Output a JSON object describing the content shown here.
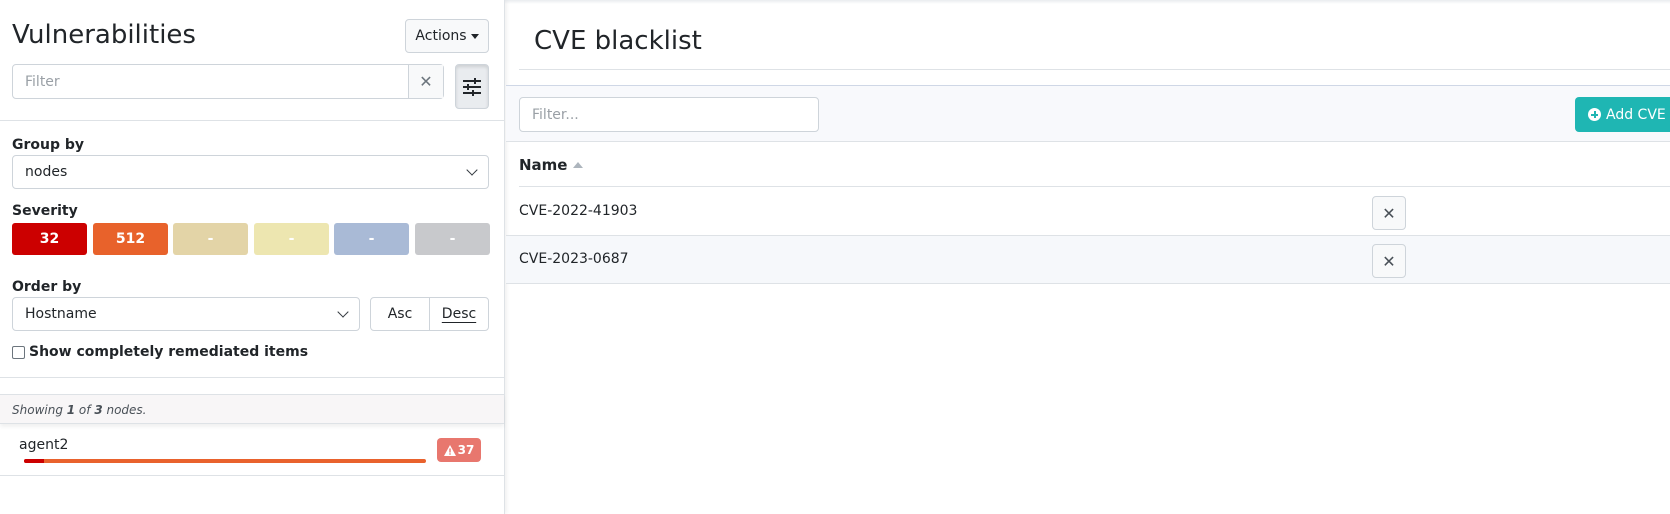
{
  "left": {
    "title": "Vulnerabilities",
    "actions_label": "Actions",
    "filter_placeholder": "Filter",
    "clear_glyph": "✕",
    "group_by_label": "Group by",
    "group_by_value": "nodes",
    "severity_label": "Severity",
    "severity": [
      {
        "label": "32",
        "color": "#cc0000"
      },
      {
        "label": "512",
        "color": "#e8622b"
      },
      {
        "label": "-",
        "color": "#e3d4a7"
      },
      {
        "label": "-",
        "color": "#ede6b0"
      },
      {
        "label": "-",
        "color": "#a9bad6"
      },
      {
        "label": "-",
        "color": "#c8c9cc"
      }
    ],
    "order_by_label": "Order by",
    "order_by_value": "Hostname",
    "asc_label": "Asc",
    "desc_label": "Desc",
    "remediated_label": "Show completely remediated items",
    "showing": {
      "prefix": "Showing ",
      "shown": "1",
      "of": " of ",
      "total": "3",
      "suffix": " nodes."
    },
    "nodes": [
      {
        "name": "agent2",
        "badge": "37",
        "critical_fraction": 0.05
      }
    ]
  },
  "right": {
    "title": "CVE blacklist",
    "filter_placeholder": "Filter...",
    "add_label": "Add CVE",
    "column_name": "Name",
    "rows": [
      {
        "name": "CVE-2022-41903"
      },
      {
        "name": "CVE-2023-0687"
      }
    ],
    "delete_glyph": "✕"
  },
  "colors": {
    "accent": "#1fb6b3",
    "critical": "#cc0000",
    "high": "#e8622b",
    "badge": "#e8776e"
  }
}
